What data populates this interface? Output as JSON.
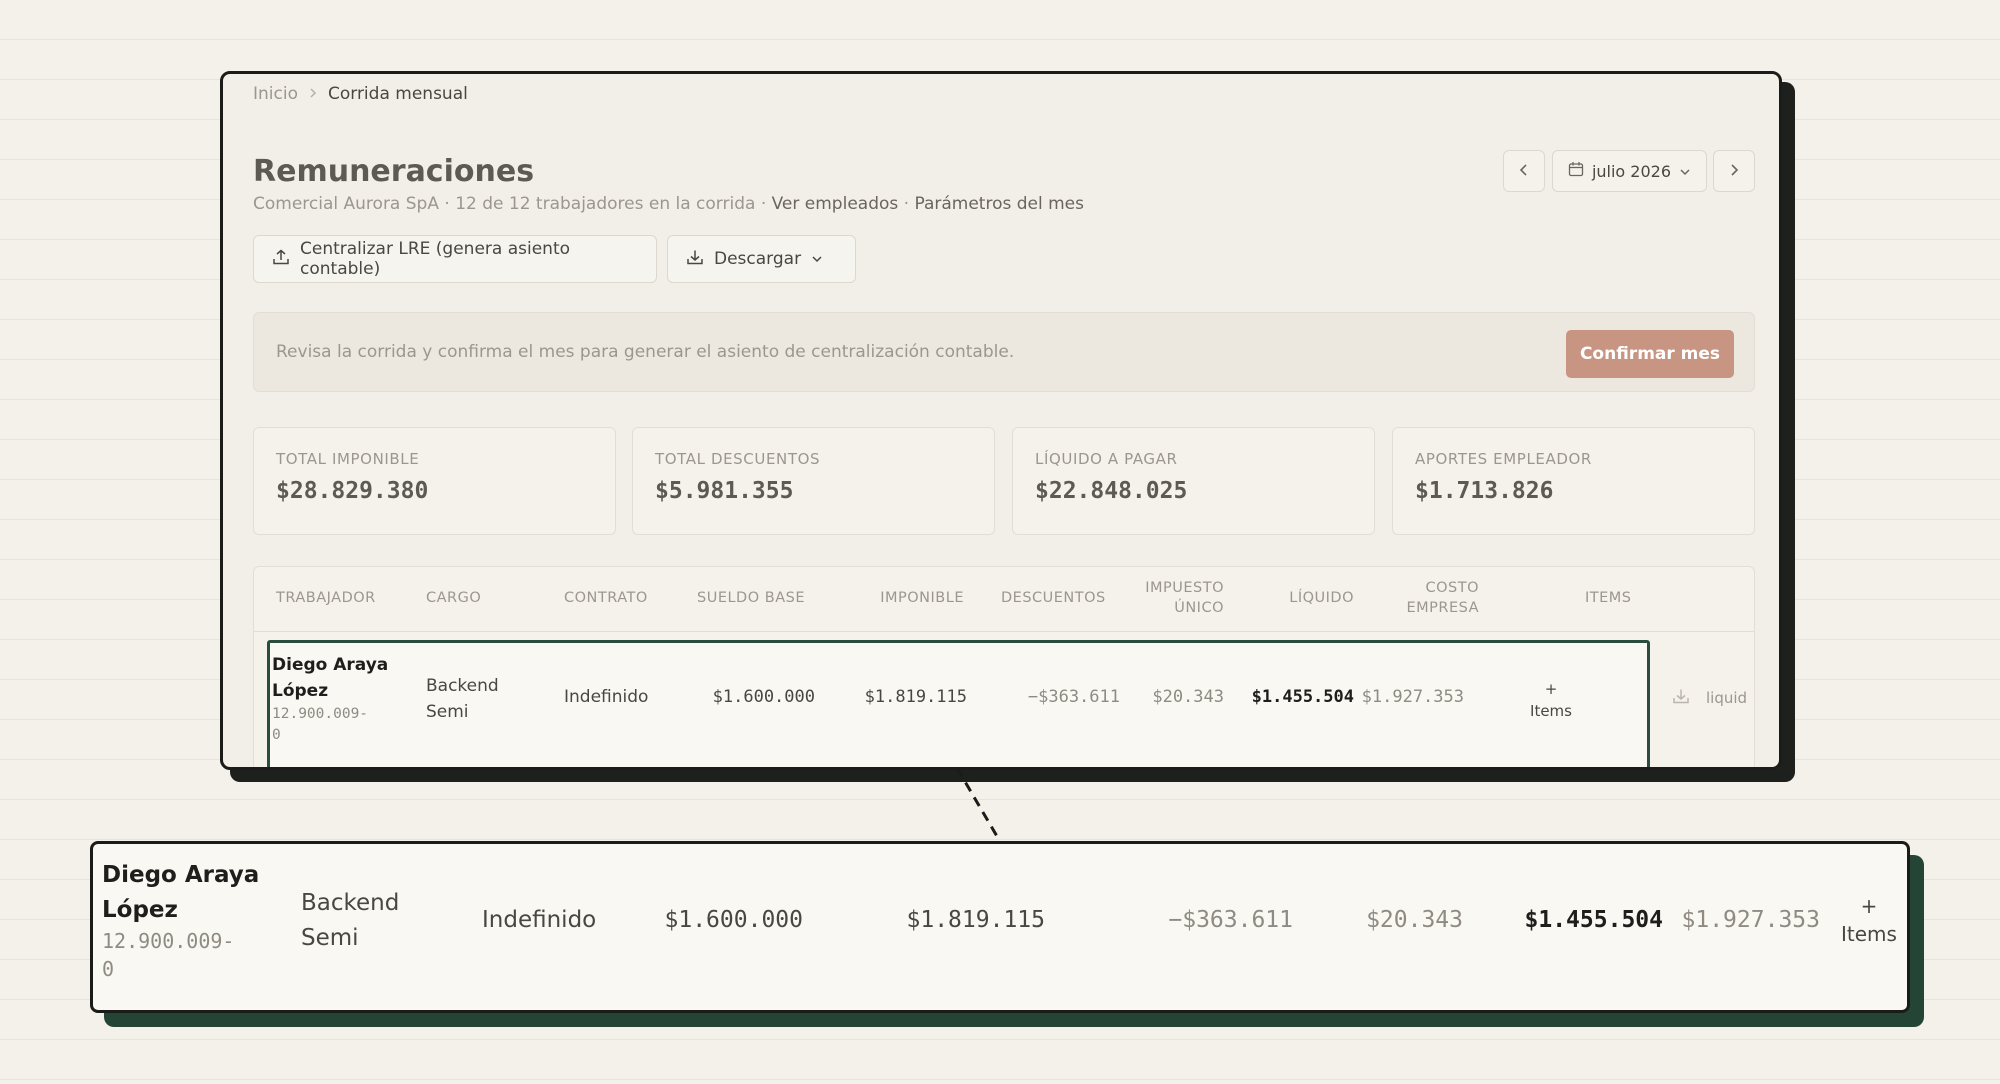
{
  "breadcrumb": {
    "home": "Inicio",
    "current": "Corrida mensual"
  },
  "page": {
    "title": "Remuneraciones",
    "company": "Comercial Aurora SpA",
    "workers_count": "12 de 12 trabajadores en la corrida",
    "link_employees": "Ver empleados",
    "link_params": "Parámetros del mes",
    "separator": "·"
  },
  "period": {
    "label": "julio 2026"
  },
  "toolbar": {
    "centralizar_label": "Centralizar LRE (genera asiento contable)",
    "descargar_label": "Descargar"
  },
  "notice": {
    "text": "Revisa la corrida y confirma el mes para generar el asiento de centralización contable.",
    "confirm_label": "Confirmar mes"
  },
  "summary": [
    {
      "label": "TOTAL IMPONIBLE",
      "value": "$28.829.380"
    },
    {
      "label": "TOTAL DESCUENTOS",
      "value": "$5.981.355"
    },
    {
      "label": "LÍQUIDO A PAGAR",
      "value": "$22.848.025"
    },
    {
      "label": "APORTES EMPLEADOR",
      "value": "$1.713.826"
    }
  ],
  "table": {
    "headers": {
      "trabajador": "TRABAJADOR",
      "cargo": "CARGO",
      "contrato": "CONTRATO",
      "sueldo_base": "SUELDO BASE",
      "imponible": "IMPONIBLE",
      "descuentos": "DESCUENTOS",
      "impuesto_1": "IMPUESTO",
      "impuesto_2": "ÚNICO",
      "liquido": "LÍQUIDO",
      "costo_1": "COSTO",
      "costo_2": "EMPRESA",
      "items": "ITEMS"
    },
    "row": {
      "name_1": "Diego Araya",
      "name_2": "López",
      "rut_1": "12.900.009-",
      "rut_2": "0",
      "cargo_1": "Backend",
      "cargo_2": "Semi",
      "contrato": "Indefinido",
      "sueldo_base": "$1.600.000",
      "imponible": "$1.819.115",
      "descuentos": "−$363.611",
      "impuesto": "$20.343",
      "liquido": "$1.455.504",
      "costo": "$1.927.353",
      "items_plus": "+",
      "items_label": "Items",
      "link": "liquid"
    }
  },
  "colors": {
    "accent": "#c79581",
    "highlight": "#2b4d3f",
    "shadow_dark": "#1e201d"
  },
  "icons": [
    "chevron-right-icon",
    "chevron-left-icon",
    "calendar-icon",
    "chevron-down-icon",
    "upload-icon",
    "download-icon"
  ]
}
